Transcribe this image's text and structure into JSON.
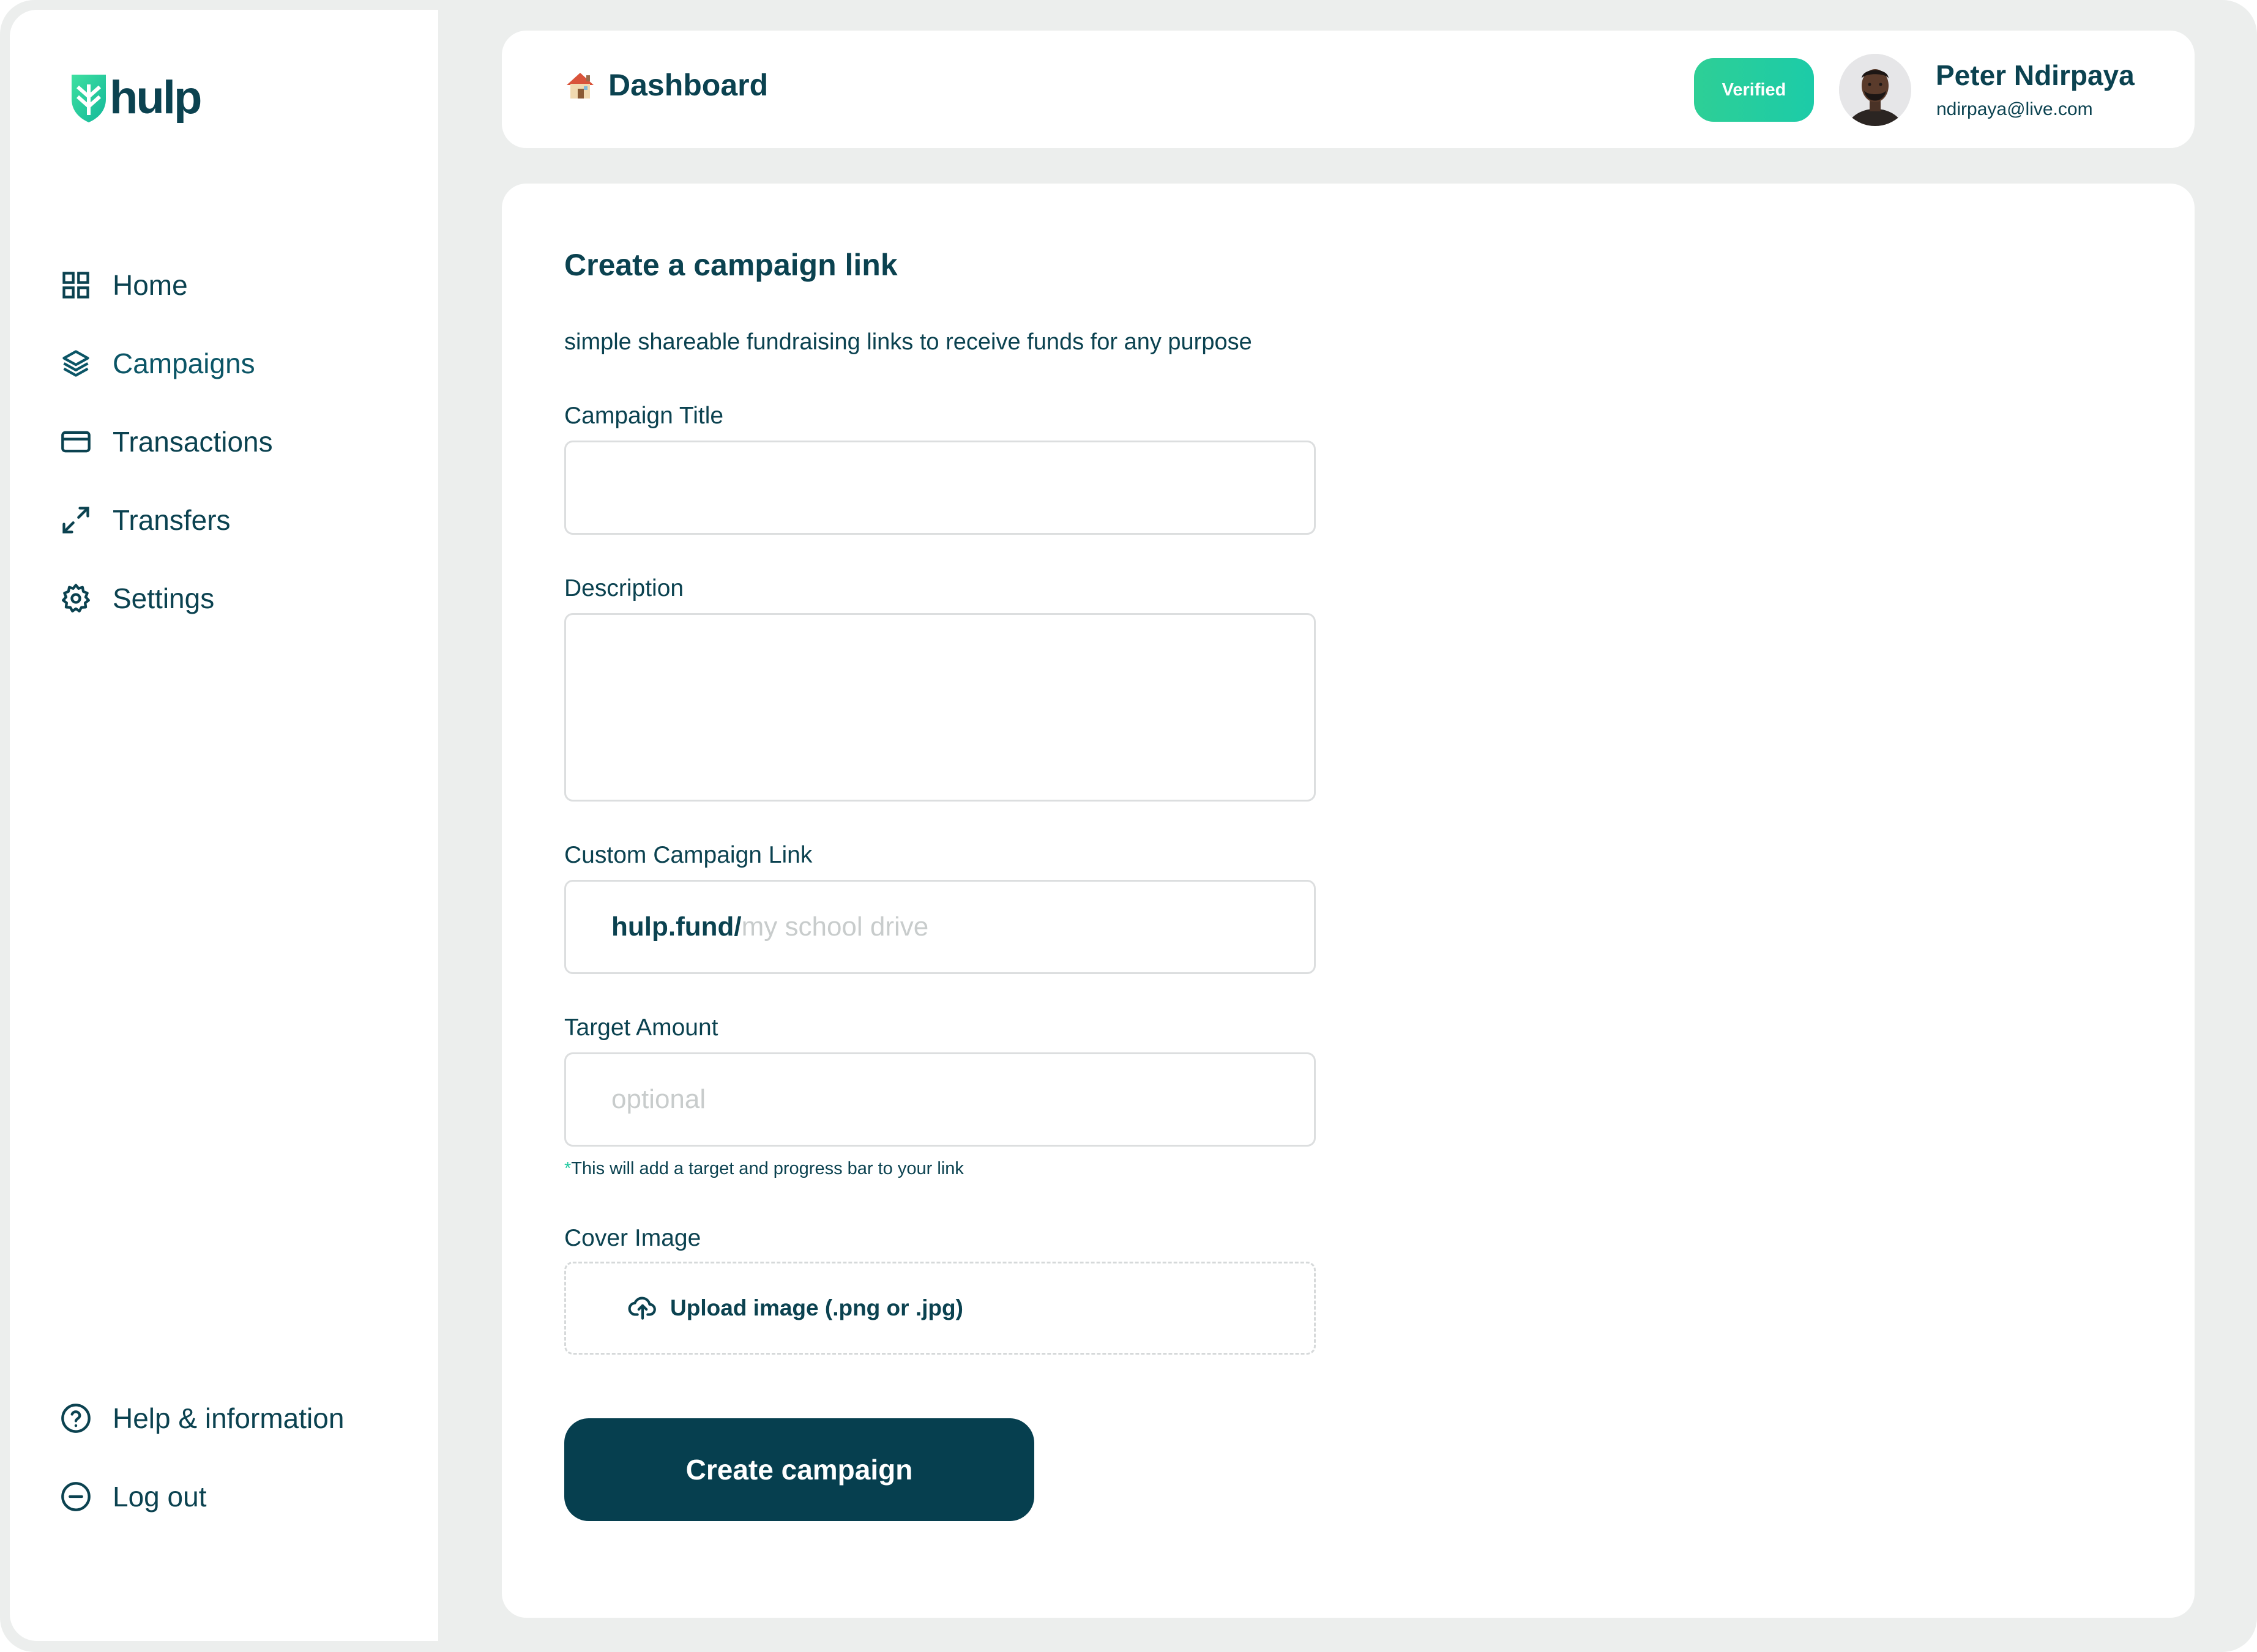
{
  "app": {
    "logo_text": "hulp"
  },
  "sidebar": {
    "items": [
      {
        "label": "Home",
        "icon": "grid-icon"
      },
      {
        "label": "Campaigns",
        "icon": "layers-icon"
      },
      {
        "label": "Transactions",
        "icon": "card-icon"
      },
      {
        "label": "Transfers",
        "icon": "arrows-icon"
      },
      {
        "label": "Settings",
        "icon": "gear-icon"
      }
    ],
    "bottom": [
      {
        "label": "Help & information",
        "icon": "help-icon"
      },
      {
        "label": "Log out",
        "icon": "logout-icon"
      }
    ],
    "active": "Campaigns"
  },
  "header": {
    "breadcrumb": "Dashboard",
    "breadcrumb_icon": "house-icon",
    "badge": "Verified",
    "user": {
      "name": "Peter Ndirpaya",
      "email": "ndirpaya@live.com"
    }
  },
  "form": {
    "title": "Create a campaign link",
    "subtitle": "simple shareable fundraising links to receive funds for any purpose",
    "campaign_title": {
      "label": "Campaign Title",
      "value": "",
      "placeholder": ""
    },
    "description": {
      "label": "Description",
      "value": "",
      "placeholder": ""
    },
    "custom_link": {
      "label": "Custom Campaign Link",
      "prefix": "hulp.fund/",
      "placeholder": "my school drive"
    },
    "target_amount": {
      "label": "Target Amount",
      "placeholder": "optional",
      "hint_star": "*",
      "hint": "This will add a target and progress bar to your link"
    },
    "cover_image": {
      "label": "Cover Image",
      "upload_label": "Upload image (.png or .jpg)"
    },
    "submit": "Create campaign"
  },
  "colors": {
    "primary": "#063f4f",
    "text": "#0b4250",
    "accent": "#22c9a0",
    "frame": "#eceeed",
    "badge_start": "#2ecf96",
    "badge_end": "#1ccba8"
  }
}
